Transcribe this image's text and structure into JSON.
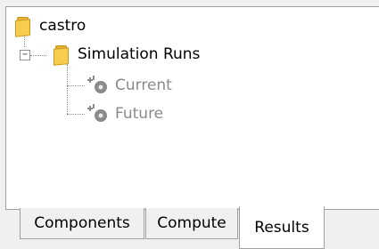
{
  "tree": {
    "root": {
      "label": "castro",
      "icon": "folder-icon"
    },
    "group": {
      "label": "Simulation Runs",
      "icon": "folder-icon",
      "expanded": true,
      "expander_symbol": "−"
    },
    "children": [
      {
        "label": "Current",
        "icon": "gear-run-icon",
        "state": "disabled"
      },
      {
        "label": "Future",
        "icon": "gear-run-icon",
        "state": "disabled"
      }
    ]
  },
  "tabs": [
    {
      "label": "Components",
      "selected": false
    },
    {
      "label": "Compute",
      "selected": false
    },
    {
      "label": "Results",
      "selected": true
    }
  ],
  "colors": {
    "folder": "#f6cd4c",
    "disabled_text": "#8a8a8a",
    "border": "#a0a0a0"
  }
}
